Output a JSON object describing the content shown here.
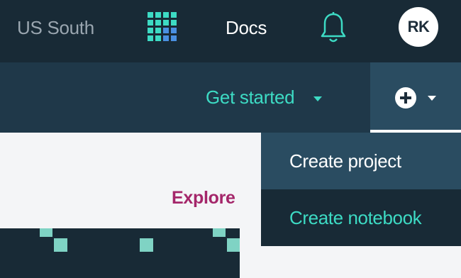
{
  "header": {
    "region": "US South",
    "docs_label": "Docs",
    "user_initials": "RK",
    "apps_icon": "apps-grid-icon",
    "notifications_icon": "bell-icon"
  },
  "subnav": {
    "get_started_label": "Get started",
    "add_menu_icon": "plus-circle-icon"
  },
  "add_menu": {
    "items": [
      {
        "label": "Create project"
      },
      {
        "label": "Create notebook"
      }
    ]
  },
  "main": {
    "explore_label": "Explore"
  },
  "colors": {
    "topbar_bg": "#182a36",
    "subbar_bg": "#1f3849",
    "accent_teal": "#3ddbc4",
    "explore_magenta": "#a4266a",
    "menu_hover_bg": "#2a4c61"
  }
}
